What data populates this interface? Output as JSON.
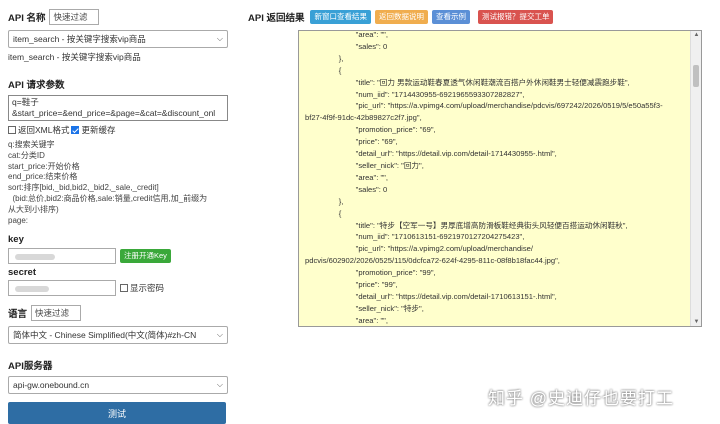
{
  "api_name": {
    "label": "API 名称",
    "filter_placeholder": "快速过滤"
  },
  "api_select": {
    "value": "item_search - 按关键字搜索vip商品"
  },
  "api_desc": "item_search - 按关键字搜索vip商品",
  "params": {
    "label": "API 请求参数",
    "text_line1": "q=鞋子",
    "text_line2": "&start_price=&end_price=&page=&cat=&discount_onl"
  },
  "options": {
    "xml_label": "返回XML格式",
    "cache_label": "更新缓存",
    "xml_checked": false,
    "cache_checked": true
  },
  "help_lines": [
    "q:搜索关键字",
    "cat:分类ID",
    "start_price:开始价格",
    "end_price:结束价格",
    "sort:排序[bid,_bid,bid2,_bid2,_sale,_credit]",
    "  (bid:总价,bid2:商品价格,sale:销量,credit信用,加_前缀为",
    "从大到小排序)",
    "page:"
  ],
  "key": {
    "label": "key",
    "register_label": "注册开通Key"
  },
  "secret": {
    "label": "secret",
    "show_label": "显示密码"
  },
  "language": {
    "label": "语言",
    "filter_placeholder": "快速过滤",
    "value": "简体中文 - Chinese Simplified(中文(简体)#zh-CN"
  },
  "server": {
    "label": "API服务器",
    "value": "api-gw.onebound.cn"
  },
  "test_button": "测试",
  "result": {
    "title": "API 返回结果",
    "buttons": [
      {
        "label": "新窗口查看结果",
        "color": "#39a0d6"
      },
      {
        "label": "返回数据说明",
        "color": "#f0ad4e"
      },
      {
        "label": "查看示例",
        "color": "#5b8fd6"
      },
      {
        "label": "测试报错？提交工单",
        "color": "#d9534f"
      }
    ],
    "lines": [
      "                        \"area\": \"\",",
      "                        \"sales\": 0",
      "                },",
      "                {",
      "                        \"title\": \"回力 男款运动鞋春夏透气休闲鞋潮流百搭户外休闲鞋男士轻便减震跑步鞋\",",
      "                        \"num_iid\": \"1714430955-6921965593307282827\",",
      "                        \"pic_url\": \"https://a.vpimg4.com/upload/merchandise/pdcvis/697242/2026/0519/5/e50a55f3-",
      "bf27-4f9f-91dc-42b89827c2f7.jpg\",",
      "                        \"promotion_price\": \"69\",",
      "                        \"price\": \"69\",",
      "                        \"detail_url\": \"https://detail.vip.com/detail-1714430955-.html\",",
      "                        \"seller_nick\": \"回力\",",
      "                        \"area\": \"\",",
      "                        \"sales\": 0",
      "                },",
      "                {",
      "                        \"title\": \"特步【空军一号】男厚底增高防滑板鞋经典街头风轻便百搭运动休闲鞋秋\",",
      "                        \"num_iid\": \"1710613151-6921970127204275423\",",
      "                        \"pic_url\": \"https://a.vpimg2.com/upload/merchandise/",
      "pdcvis/602902/2026/0525/115/0dcfca72-624f-4295-811c-08f8b18fac44.jpg\",",
      "                        \"promotion_price\": \"99\",",
      "                        \"price\": \"99\",",
      "                        \"detail_url\": \"https://detail.vip.com/detail-1710613151-.html\",",
      "                        \"seller_nick\": \"特步\",",
      "                        \"area\": \"\","
    ]
  },
  "watermark": "知乎 @史迪仔也要打工"
}
